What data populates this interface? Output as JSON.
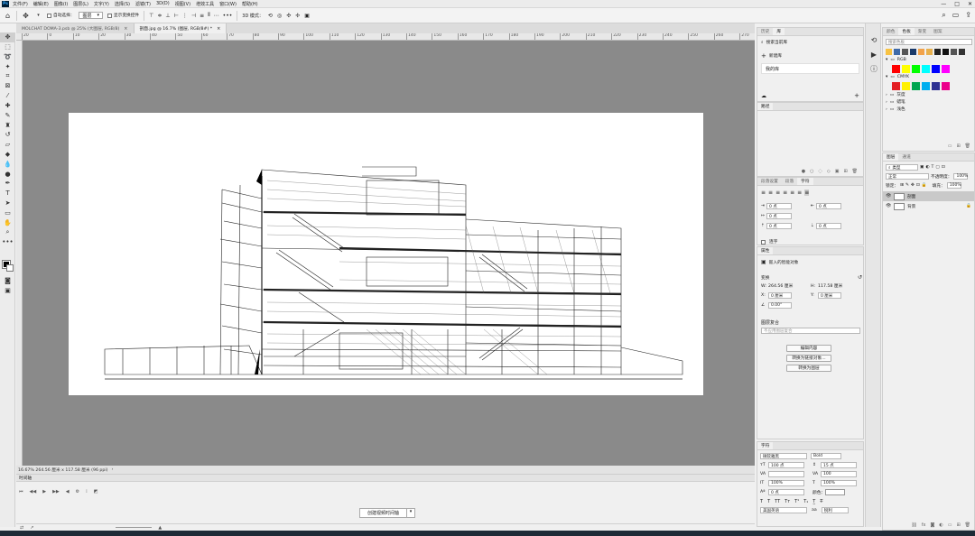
{
  "app": {
    "logo": "Ps"
  },
  "menu": [
    "文件(F)",
    "编辑(E)",
    "图像(I)",
    "图层(L)",
    "文字(Y)",
    "选择(S)",
    "滤镜(T)",
    "3D(D)",
    "视图(V)",
    "增效工具",
    "窗口(W)",
    "帮助(H)"
  ],
  "options": {
    "auto_select": "自动选择：",
    "layer_mode": "图层",
    "show_transform": "显示变换控件",
    "mode_3d": "3D 模式："
  },
  "tabs": [
    {
      "label": "MOLCHAT DOMA-3.psb @ 25% (大图层, RGB/8)",
      "active": false
    },
    {
      "label": "剖面.jpg @ 16.7% (图层, RGB/8#) *",
      "active": true
    }
  ],
  "ruler": {
    "h": [
      "20",
      "0",
      "10",
      "20",
      "30",
      "40",
      "50",
      "60",
      "70",
      "80",
      "90",
      "100",
      "110",
      "120",
      "130",
      "140",
      "150",
      "160",
      "170",
      "180",
      "190",
      "200",
      "210",
      "220",
      "230",
      "240",
      "250",
      "260",
      "270",
      "280"
    ]
  },
  "status": {
    "text": "16.67%  264.56 厘米 x 117.58 厘米 (96 ppi)"
  },
  "timeline": {
    "title": "时间轴",
    "create_button": "创建视频时间轴"
  },
  "history": {
    "tabs": [
      "历史",
      "库"
    ],
    "search": "搜索当前库",
    "new_library": "新建库",
    "library_name": "我的库"
  },
  "paths": {
    "tab": "路径"
  },
  "para": {
    "tabs": [
      "段落设置",
      "段落",
      "字符"
    ],
    "fields": [
      "0 点",
      "0 点",
      "0 点",
      "0 点",
      "0 点"
    ],
    "hyphen": "连字"
  },
  "props": {
    "tab": "属性",
    "layer_type": "嵌入的智能对象",
    "transform": "变换",
    "w_label": "W:",
    "w_val": "264.56 厘米",
    "h_label": "H:",
    "h_val": "117.58 厘米",
    "x_label": "X:",
    "x_val": "0 厘米",
    "y_label": "Y:",
    "y_val": "0 厘米",
    "angle": "0.00°",
    "comp_label": "图层复合",
    "comp_value": "不应用图层复合",
    "edit_contents": "编辑内容",
    "convert_linked": "转换为链接对象...",
    "convert_layer": "转换为图层"
  },
  "char": {
    "tab": "字符",
    "font": "微软雅黑",
    "style": "Bold",
    "size": "100 点",
    "leading": "15 点",
    "tracking": "100",
    "scale_v": "100%",
    "scale_h": "100%",
    "baseline": "0 点",
    "color_label": "颜色：",
    "lang": "美国英语",
    "aa": "锐利"
  },
  "swatches": {
    "tabs": [
      "颜色",
      "色板",
      "渐变",
      "图案"
    ],
    "search": "搜索色板",
    "groups": [
      "RGB",
      "CMYK",
      "灰度",
      "蜡笔",
      "浅色"
    ],
    "top_colors": [
      "#f7c243",
      "#3f6aa8",
      "#555555",
      "#1a3a6a",
      "#f2a24a",
      "#e8b04c",
      "#222222",
      "#111111",
      "#555555",
      "#333333"
    ],
    "rgb_colors": [
      "#ff0000",
      "#ffff00",
      "#00ff00",
      "#00ffff",
      "#0000ff",
      "#ff00ff"
    ],
    "cmyk_colors": [
      "#e31e24",
      "#fff100",
      "#00a651",
      "#00aeef",
      "#2e3192",
      "#ec008c"
    ]
  },
  "layers": {
    "tabs": [
      "图层",
      "通道"
    ],
    "filter": "类型",
    "blend": "正常",
    "opacity_label": "不透明度：",
    "opacity": "100%",
    "lock_label": "锁定：",
    "fill_label": "填充：",
    "fill": "100%",
    "items": [
      {
        "name": "剖面",
        "selected": true
      },
      {
        "name": "背景",
        "selected": false
      }
    ]
  }
}
